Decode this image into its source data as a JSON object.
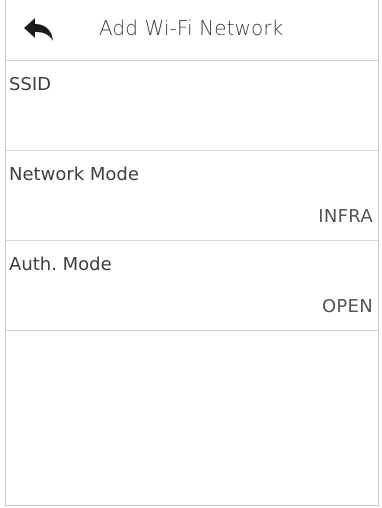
{
  "header": {
    "back_icon": "back-arrow-icon",
    "title": "Add Wi-Fi Network"
  },
  "fields": [
    {
      "label": "SSID",
      "value": ""
    },
    {
      "label": "Network Mode",
      "value": "INFRA"
    },
    {
      "label": "Auth. Mode",
      "value": "OPEN"
    }
  ],
  "colors": {
    "background": "#ffffff",
    "divider": "#d6d6d6",
    "text": "#3e3e3e",
    "icon": "#1a1a1a"
  }
}
